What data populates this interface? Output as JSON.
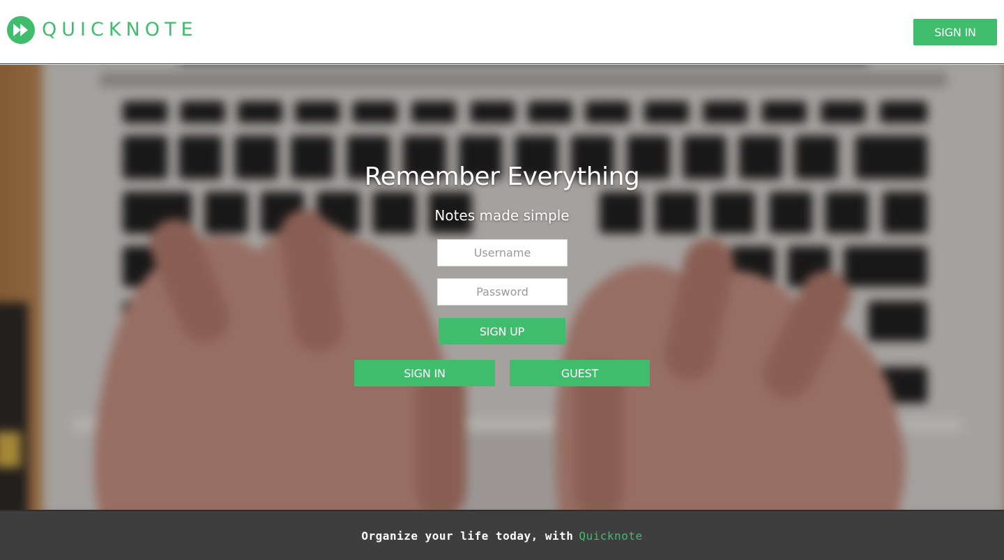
{
  "brand": {
    "name": "QUICKNOTE",
    "color": "#3fbd6c",
    "icon": "fast-forward-icon"
  },
  "header": {
    "signin_label": "SIGN IN"
  },
  "hero": {
    "title": "Remember Everything",
    "subtitle": "Notes made simple",
    "background": "blurred-hands-typing-on-laptop-keyboard"
  },
  "form": {
    "username_placeholder": "Username",
    "password_placeholder": "Password",
    "signup_label": "SIGN UP",
    "signin_label": "SIGN IN",
    "guest_label": "GUEST"
  },
  "footer": {
    "text": "Organize your life today, with",
    "brand": "Quicknote",
    "background": "#3e3e3e"
  }
}
